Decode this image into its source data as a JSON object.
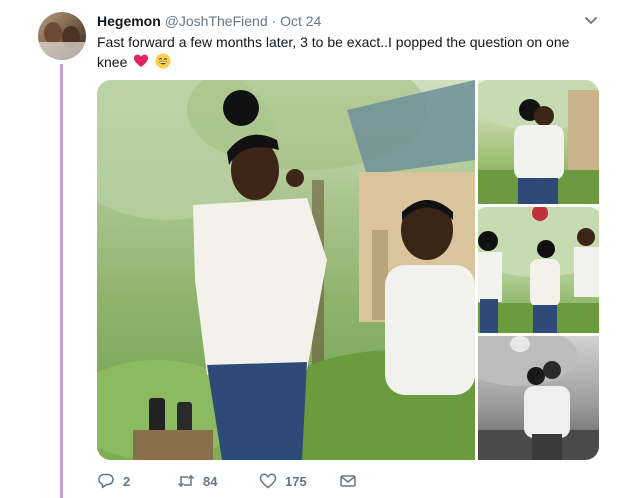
{
  "tweet": {
    "author_name": "Hegemon",
    "author_handle": "@JoshTheFiend",
    "separator": "·",
    "date": "Oct 24",
    "text": "Fast forward a few months later, 3 to be exact..I popped the question on one knee",
    "emojis": [
      "red-heart",
      "grinning-face"
    ],
    "photos": [
      {
        "name": "proposal-main"
      },
      {
        "name": "couple-embrace"
      },
      {
        "name": "couple-with-onlooker"
      },
      {
        "name": "couple-black-white"
      }
    ],
    "actions": {
      "reply_count": "2",
      "retweet_count": "84",
      "like_count": "175"
    }
  },
  "colors": {
    "thread_line": "#c9a0d4",
    "secondary_text": "#657786",
    "heart": "#e0245e"
  }
}
